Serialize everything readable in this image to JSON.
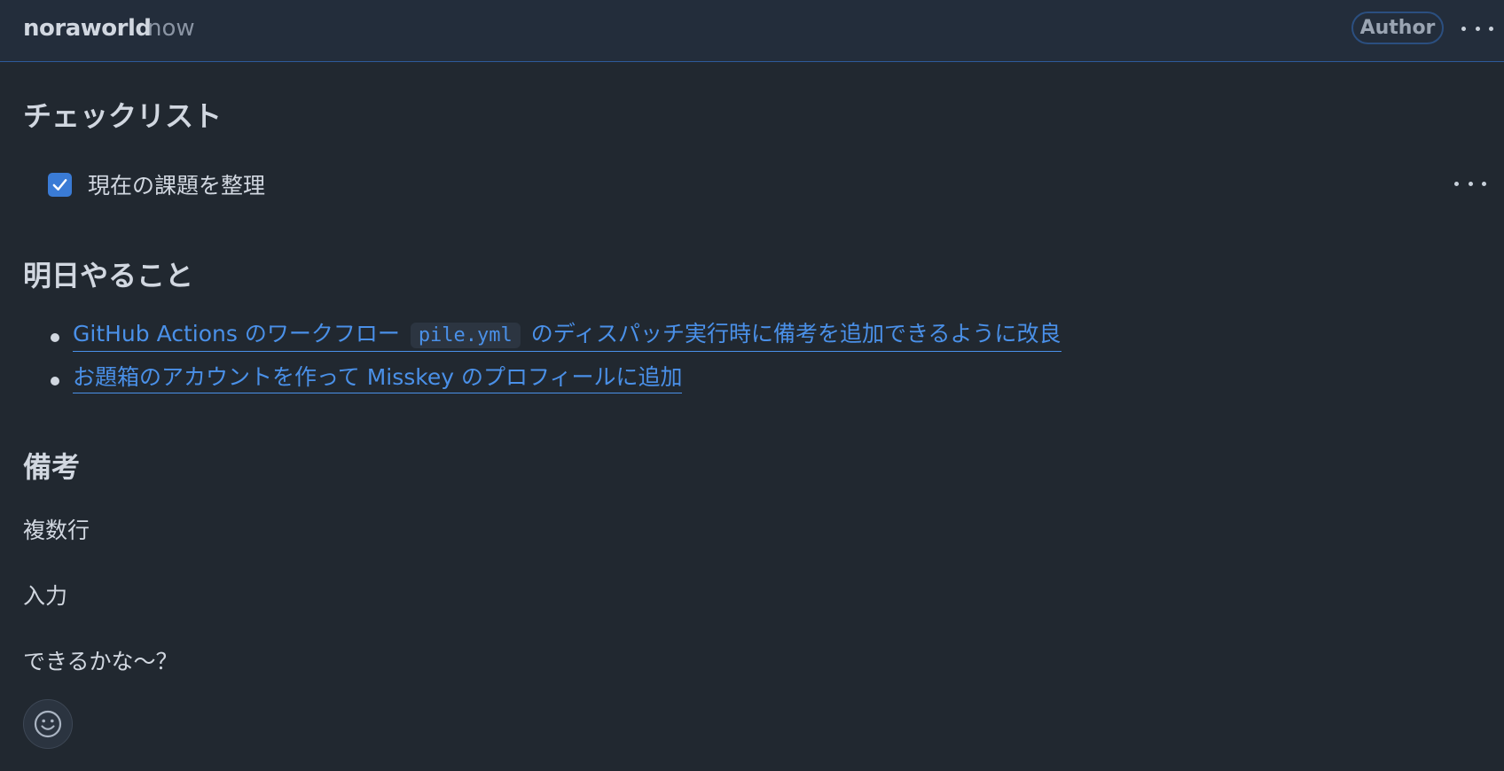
{
  "comment": {
    "author": "noraworld",
    "timestamp": "now",
    "badge": "Author"
  },
  "checklist": {
    "heading": "チェックリスト",
    "items": [
      {
        "label": "現在の課題を整理",
        "checked": true
      }
    ]
  },
  "tomorrow": {
    "heading": "明日やること",
    "items": [
      {
        "text_before": "GitHub Actions のワークフロー",
        "code": "pile.yml",
        "text_after": "のディスパッチ実行時に備考を追加できるように改良"
      },
      {
        "text": "お題箱のアカウントを作って Misskey のプロフィールに追加"
      }
    ]
  },
  "notes": {
    "heading": "備考",
    "lines": [
      "複数行",
      "入力",
      "できるかな〜？"
    ]
  },
  "icons": {
    "more": "kebab-horizontal-icon",
    "check": "check-icon",
    "reaction": "smiley-icon"
  },
  "colors": {
    "background": "#212830",
    "header": "#232d3b",
    "accent": "#4a90e8",
    "checkbox": "#3a7bd5",
    "text": "#d1d7e0",
    "muted": "#8a94a3"
  }
}
